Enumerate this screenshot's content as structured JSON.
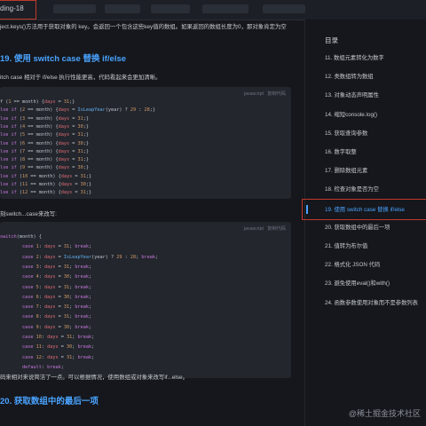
{
  "tab": {
    "label": "ding-18"
  },
  "article": {
    "intro": "ject.keys()方法用于获取对象的 key。会返回一个包含这些key值的数组。如果返回的数组长度为0，那对象肯定为空",
    "heading19": "19. 使用 switch case 替换 if/else",
    "desc19": "itch case 相对于 if/else 执行性能更高，代码看起来会更加清晰。",
    "desc_switch": "刻switch...case来改写:",
    "conclusion": "码来相对来说简洁了一点。可以根据情况，使用数组或对象来改写if...else。",
    "heading20": "20. 获取数组中的最后一项"
  },
  "code1": {
    "lang": "javascript",
    "copy": "复制代码",
    "lines": [
      "f (1 == month) {days = 31;}",
      "lse if (2 == month) {days = IsLeapYear(year) ? 29 : 28;}",
      "lse if (3 == month) {days = 31;}",
      "lse if (4 == month) {days = 30;}",
      "lse if (5 == month) {days = 31;}",
      "lse if (6 == month) {days = 30;}",
      "lse if (7 == month) {days = 31;}",
      "lse if (8 == month) {days = 31;}",
      "lse if (9 == month) {days = 30;}",
      "lse if (10 == month) {days = 31;}",
      "lse if (11 == month) {days = 30;}",
      "lse if (12 == month) {days = 31;}"
    ]
  },
  "code2": {
    "lang": "javascript",
    "copy": "复制代码",
    "lines": [
      "switch(month) {",
      "        case 1: days = 31; break;",
      "        case 2: days = IsLeapYear(year) ? 29 : 28; break;",
      "        case 3: days = 31; break;",
      "        case 4: days = 30; break;",
      "        case 5: days = 31; break;",
      "        case 6: days = 30; break;",
      "        case 7: days = 31; break;",
      "        case 8: days = 31; break;",
      "        case 9: days = 30; break;",
      "        case 10: days = 31; break;",
      "        case 11: days = 30; break;",
      "        case 12: days = 31; break;",
      "        default: break;"
    ]
  },
  "toc": {
    "title": "目录",
    "items": [
      "11. 数组元素转化为数字",
      "12. 类数组转为数组",
      "13. 对象动态声明属性",
      "14. 缩短console.log()",
      "15. 获取查询参数",
      "16. 数字取整",
      "17. 删除数组元素",
      "18. 检查对象是否为空",
      "19. 使用 switch case 替换 if/else",
      "20. 获取数组中的最后一项",
      "21. 值转为布尔值",
      "22. 格式化 JSON 代码",
      "23. 避免使用eval()和with()",
      "24. 函数参数使用对象而不是参数列表"
    ],
    "active_index": 8
  },
  "watermark": "@稀土掘金技术社区",
  "colors": {
    "accent": "#4aa3ff",
    "highlight_border": "#c0392b",
    "background": "#15171c",
    "code_bg": "#23262d"
  }
}
